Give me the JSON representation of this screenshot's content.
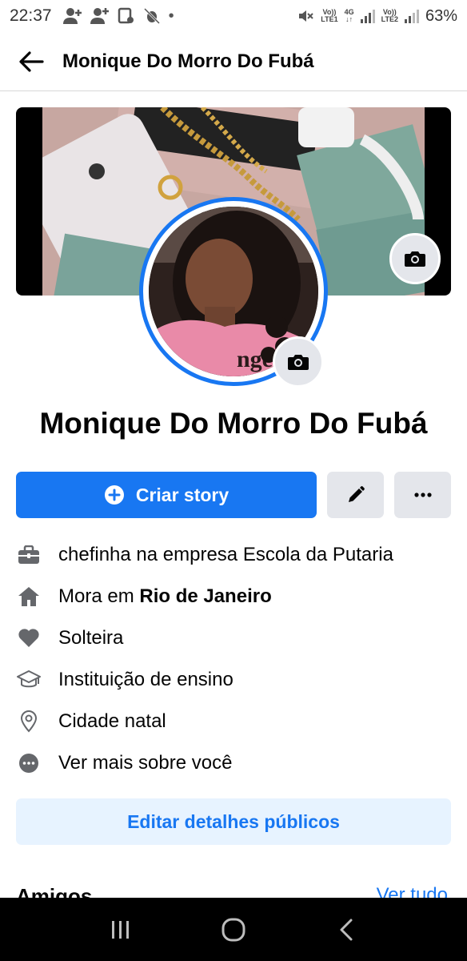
{
  "status_bar": {
    "time": "22:37",
    "battery": "63%",
    "sim1_tag": "Vo)) LTE1",
    "sim1_net": "4G",
    "sim2_tag": "Vo)) LTE2"
  },
  "header": {
    "title": "Monique Do Morro Do Fubá",
    "back_icon": "arrow-left-icon"
  },
  "profile": {
    "name": "Monique Do Morro Do Fubá"
  },
  "actions": {
    "story_label": "Criar story",
    "story_icon": "plus-circle-icon",
    "edit_icon": "pencil-icon",
    "more_icon": "ellipsis-icon"
  },
  "details": {
    "work": "chefinha na empresa Escola da Putaria",
    "lives_prefix": "Mora em ",
    "lives_city": "Rio de Janeiro",
    "relationship": "Solteira",
    "education": "Instituição de ensino",
    "hometown": "Cidade natal",
    "more": "Ver mais sobre você"
  },
  "edit_public_label": "Editar detalhes públicos",
  "friends": {
    "title": "Amigos",
    "see_all": "Ver tudo"
  },
  "colors": {
    "accent": "#1877f2",
    "light_accent_bg": "#e7f3ff",
    "button_gray": "#e4e6eb",
    "icon_gray": "#65676b"
  }
}
